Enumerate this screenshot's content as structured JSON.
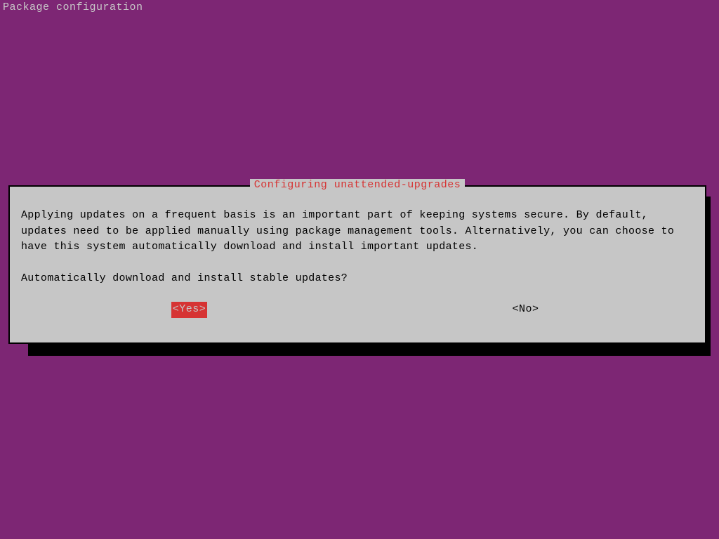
{
  "header": {
    "title": "Package configuration"
  },
  "dialog": {
    "title": " Configuring unattended-upgrades ",
    "description": "Applying updates on a frequent basis is an important part of keeping systems secure. By default, updates need to be applied manually using package management tools. Alternatively, you can choose to have this system automatically download and install important updates.",
    "prompt": "Automatically download and install stable updates?",
    "buttons": {
      "yes": "<Yes>",
      "no": "<No>"
    },
    "selected": "yes"
  },
  "colors": {
    "background": "#7d2674",
    "dialog_bg": "#c6c6c6",
    "accent": "#d63333",
    "shadow": "#000000"
  }
}
